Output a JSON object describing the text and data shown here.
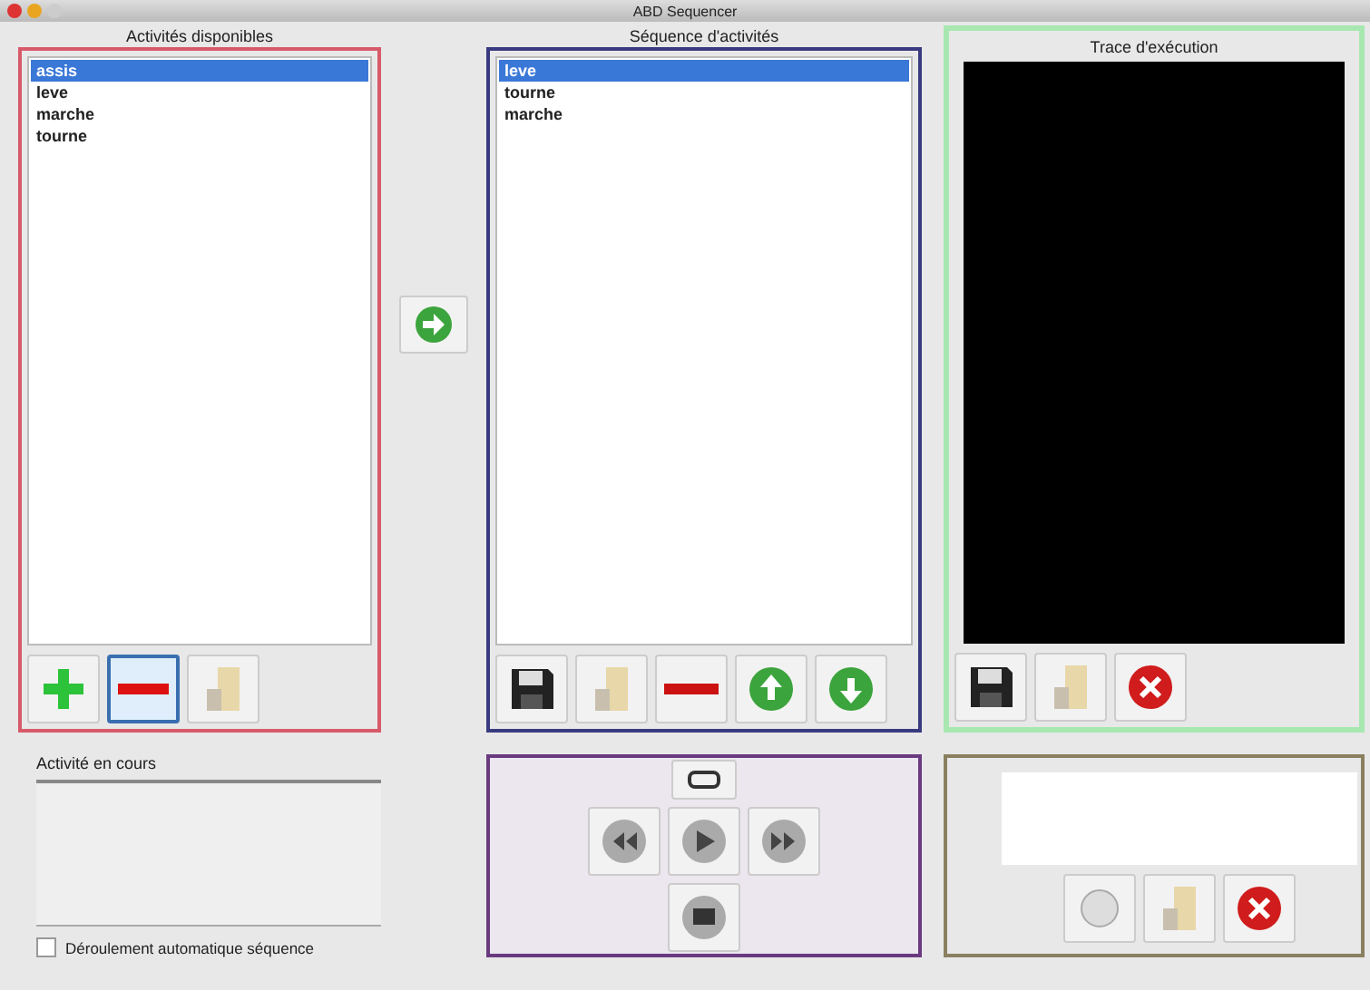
{
  "window": {
    "title": "ABD Sequencer"
  },
  "available": {
    "title": "Activités disponibles",
    "items": [
      {
        "label": "assis",
        "selected": true
      },
      {
        "label": "leve",
        "selected": false
      },
      {
        "label": "marche",
        "selected": false
      },
      {
        "label": "tourne",
        "selected": false
      }
    ]
  },
  "sequence": {
    "title": "Séquence d'activités",
    "items": [
      {
        "label": "leve",
        "selected": true
      },
      {
        "label": "tourne",
        "selected": false
      },
      {
        "label": "marche",
        "selected": false
      }
    ]
  },
  "trace": {
    "title": "Trace d'exécution"
  },
  "current": {
    "label": "Activité en cours"
  },
  "auto": {
    "label": "Déroulement automatique séquence",
    "checked": false
  }
}
